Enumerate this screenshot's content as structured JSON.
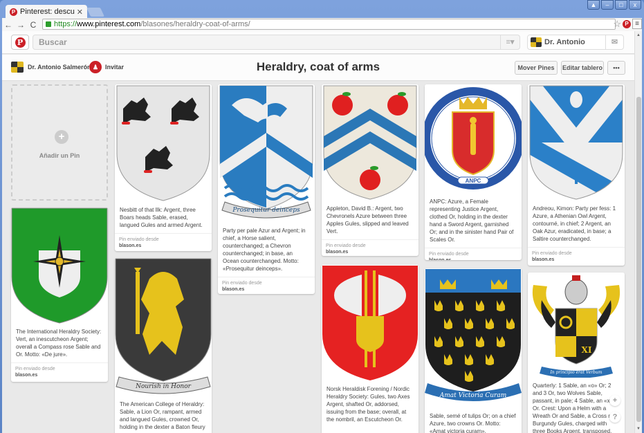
{
  "browser": {
    "tab_title": "Pinterest: descubre ide",
    "url_scheme": "https://",
    "url_host": "www.pinterest.com",
    "url_path": "/blasones/heraldry-coat-of-arms/"
  },
  "topbar": {
    "search_placeholder": "Buscar",
    "user_name": "Dr. Antonio"
  },
  "board": {
    "owner": "Dr. Antonio Salmerón",
    "invite": "Invitar",
    "title": "Heraldry, coat of arms",
    "move_pins": "Mover Pines",
    "edit_board": "Editar tablero",
    "more": "•••"
  },
  "add_pin": "Añadir un Pin",
  "pins": [
    {
      "desc": "Nesbitt of that Ilk: Argent, three Boars heads Sable, erased, langued Gules and armed Argent.",
      "src_label": "Pin enviado desde",
      "src": "blason.es"
    },
    {
      "desc": "Party per pale Azur and Argent; in chief, a Horse salient, counterchanged; a Chevron counterchanged; in base, an Ocean counterchanged. Motto: «Prosequitur deinceps».",
      "motto": "Prosequitur deinceps",
      "src_label": "Pin enviado desde",
      "src": "blason.es"
    },
    {
      "desc": "Appleton, David B.: Argent, two Chevronels Azure between three Apples Gules, slipped and leaved Vert.",
      "src_label": "Pin enviado desde",
      "src": "blason.es"
    },
    {
      "desc": "ANPC: Azure, a Female representing Justice Argent, clothed Or, holding in the dexter hand a Sword Argent, garnished Or; and in the sinister hand Pair of Scales Or.",
      "seal_text": "ANPC",
      "src_label": "Pin enviado desde",
      "src": "blason.es"
    },
    {
      "desc": "Andreou, Kimon: Party per fess: 1 Azure, a Athenian Owl Argent, contourné, in chief; 2 Argent, an Oak Azur, eradicated, in base; a Saltire counterchanged.",
      "src_label": "Pin enviado desde",
      "src": "blason.es"
    },
    {
      "desc": "The International Heraldry Society: Vert, an inescutcheon Argent; overall a Compass rose Sable and Or. Motto: «De jure».",
      "src_label": "Pin enviado desde",
      "src": "blason.es"
    },
    {
      "desc": "The American College of Heraldry: Sable, a Lion Or, rampant, armed and langued Gules, crowned Or, holding in the dexter a Baton fleury",
      "motto": "Nourish in Honor"
    },
    {
      "desc": "Norsk Heraldisk Forening / Nordic Heraldry Society: Gules, two Axes Argent, shafted Or, addorsed, issuing from the base; overall, at the nombril, an Escutcheon Or."
    },
    {
      "desc": "Sable, semé of tulips Or; on a chief Azure, two crowns Or. Motto: «Amat victoria curam».",
      "motto": "Amat Victoria Curam"
    },
    {
      "desc": "Quarterly: 1 Sable, an «o» Or; 2 and 3 Or, two Wolves Sable, passant, in pale; 4 Sable, an «x» Or. Crest: Upon a Helm with a Wreath Or and Sable, a Cross r Burgundy Gules, charged with three Books Argent, transposed,",
      "motto": "In principio erat Verbum",
      "shield_text": "XI"
    }
  ],
  "floating": {
    "plus": "+",
    "help": "?"
  }
}
